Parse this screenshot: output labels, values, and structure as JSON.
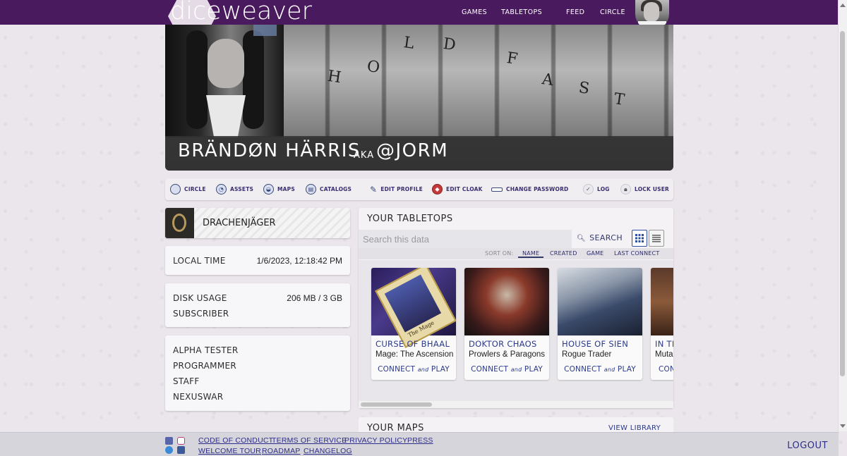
{
  "nav": {
    "logo": "diceweaver",
    "links": [
      "GAMES",
      "TABLETOPS",
      "FEED",
      "CIRCLE"
    ]
  },
  "profile": {
    "name": "BRÄNDØN HÄRRIS",
    "aka": "AKA",
    "handle": "@JORM",
    "banner_tattoo": [
      "H",
      "O",
      "L",
      "D",
      "F",
      "A",
      "S",
      "T"
    ]
  },
  "actions": {
    "circle": "CIRCLE",
    "assets": "ASSETS",
    "maps": "MAPS",
    "catalogs": "CATALOGS",
    "edit_profile": "EDIT PROFILE",
    "edit_cloak": "EDIT CLOAK",
    "change_password": "CHANGE PASSWORD",
    "log": "LOG",
    "lock_user": "LOCK USER"
  },
  "group": {
    "name": "DRACHENJÄGER"
  },
  "local_time": {
    "label": "LOCAL TIME",
    "value": "1/6/2023, 12:18:42 PM"
  },
  "disk": {
    "label": "DISK USAGE",
    "value": "206 MB / 3 GB",
    "subscriber": "SUBSCRIBER"
  },
  "roles": [
    "ALPHA TESTER",
    "PROGRAMMER",
    "STAFF",
    "NEXUSWAR"
  ],
  "tabletops": {
    "title": "YOUR TABLETOPS",
    "search_placeholder": "Search this data",
    "search_label": "SEARCH",
    "sort_label": "SORT ON:",
    "sort_options": [
      "NAME",
      "CREATED",
      "GAME",
      "LAST CONNECT"
    ],
    "active_sort": "NAME",
    "connect": "CONNECT",
    "and": "and",
    "play": "PLAY",
    "items": [
      {
        "title": "CURSE OF BHAAL",
        "game": "Mage: The Ascension",
        "art_label": "The Mage"
      },
      {
        "title": "DOKTOR CHAOS",
        "game": "Prowlers & Paragons"
      },
      {
        "title": "HOUSE OF SIEN",
        "game": "Rogue Trader"
      },
      {
        "title": "IN THE",
        "game": "Muta"
      }
    ]
  },
  "maps": {
    "title": "YOUR MAPS",
    "view_library": "VIEW LIBRARY"
  },
  "footer": {
    "row1": [
      "CODE OF CONDUCT",
      "TERMS OF SERVICE",
      "PRIVACY POLICY",
      "PRESS"
    ],
    "row2": [
      "WELCOME TOUR",
      "ROADMAP",
      "CHANGELOG"
    ],
    "logout": "LOGOUT"
  },
  "colors": {
    "nav_bg": "#4a1a5e",
    "accent": "#2c3a8a"
  }
}
